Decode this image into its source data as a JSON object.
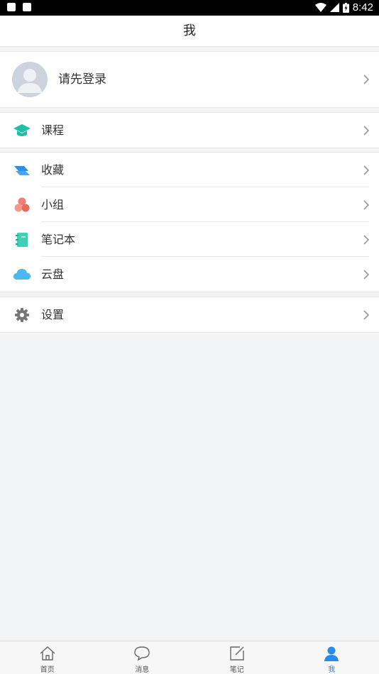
{
  "status_bar": {
    "time": "8:42"
  },
  "header": {
    "title": "我"
  },
  "profile": {
    "label": "请先登录"
  },
  "menu": {
    "course": "课程",
    "favorites": "收藏",
    "group": "小组",
    "notebook": "笔记本",
    "cloud": "云盘",
    "settings": "设置"
  },
  "tabs": [
    {
      "label": "首页",
      "icon": "home-icon"
    },
    {
      "label": "消息",
      "icon": "message-icon"
    },
    {
      "label": "笔记",
      "icon": "note-icon"
    },
    {
      "label": "我",
      "icon": "user-icon"
    }
  ],
  "colors": {
    "accent": "#2a8ae8",
    "course": "#1fbfa3",
    "favorites": "#2f8fe0",
    "group": "#ef7f70",
    "notebook": "#3fcfb2",
    "cloud": "#4cb7f3",
    "settings": "#777777"
  }
}
